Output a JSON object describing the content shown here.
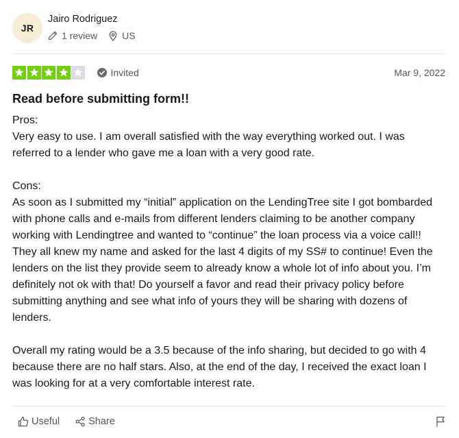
{
  "reviewer": {
    "initials": "JR",
    "name": "Jairo Rodriguez",
    "reviews": "1 review",
    "country": "US",
    "icons": {
      "reviews": "pencil-icon",
      "country": "location-pin-icon"
    }
  },
  "rating": {
    "stars": 4,
    "max_stars": 5,
    "star_color": "#73cf11",
    "empty_star_color": "#dcdce6",
    "verification": "Invited",
    "verification_icon": "check-circle-icon",
    "date": "Mar 9, 2022"
  },
  "review": {
    "title": "Read before submitting form!!",
    "pros_label": "Pros:",
    "pros_text": "Very easy to use. I am overall satisfied with the way everything worked out. I was referred to a lender who gave me a loan with a very good rate.",
    "cons_label": "Cons:",
    "cons_text": "As soon as I submitted my “initial” application on the LendingTree site I got bombarded with phone calls and e-mails from different lenders claiming to be another company working with Lendingtree and wanted to “continue” the loan process via a voice call!! They all knew my name and asked for the last 4 digits of my SS# to continue! Even the lenders on the list they provide seem to already know a whole lot of info about you. I’m definitely not ok with that! Do yourself a favor and read their privacy policy before submitting anything and see what info of yours they will be sharing with dozens of lenders.",
    "summary_text": "Overall my rating would be a 3.5 because of the info sharing, but decided to go with 4 because there are no half stars. Also, at the end of the day, I received the exact loan I was looking for at a very comfortable interest rate."
  },
  "actions": {
    "useful_label": "Useful",
    "share_label": "Share",
    "icons": {
      "useful": "thumbs-up-icon",
      "share": "share-icon",
      "report": "flag-icon"
    }
  }
}
